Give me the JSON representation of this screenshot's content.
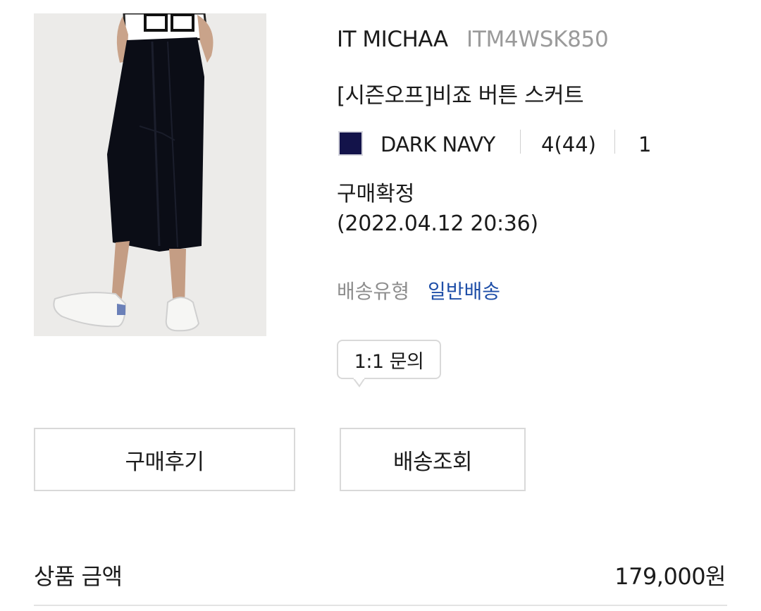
{
  "product": {
    "brand": "IT MICHAA",
    "code": "ITM4WSK850",
    "name": "[시즌오프]비죠 버튼 스커트",
    "color_name": "DARK NAVY",
    "color_hex": "#13134a",
    "size": "4(44)",
    "quantity": "1"
  },
  "order": {
    "status": "구매확정",
    "status_date": "(2022.04.12 20:36)"
  },
  "shipping": {
    "label": "배송유형",
    "value": "일반배송"
  },
  "inquiry_label": "1:1 문의",
  "buttons": {
    "review": "구매후기",
    "track": "배송조회"
  },
  "amount": {
    "label": "상품 금액",
    "value": "179,000원"
  }
}
